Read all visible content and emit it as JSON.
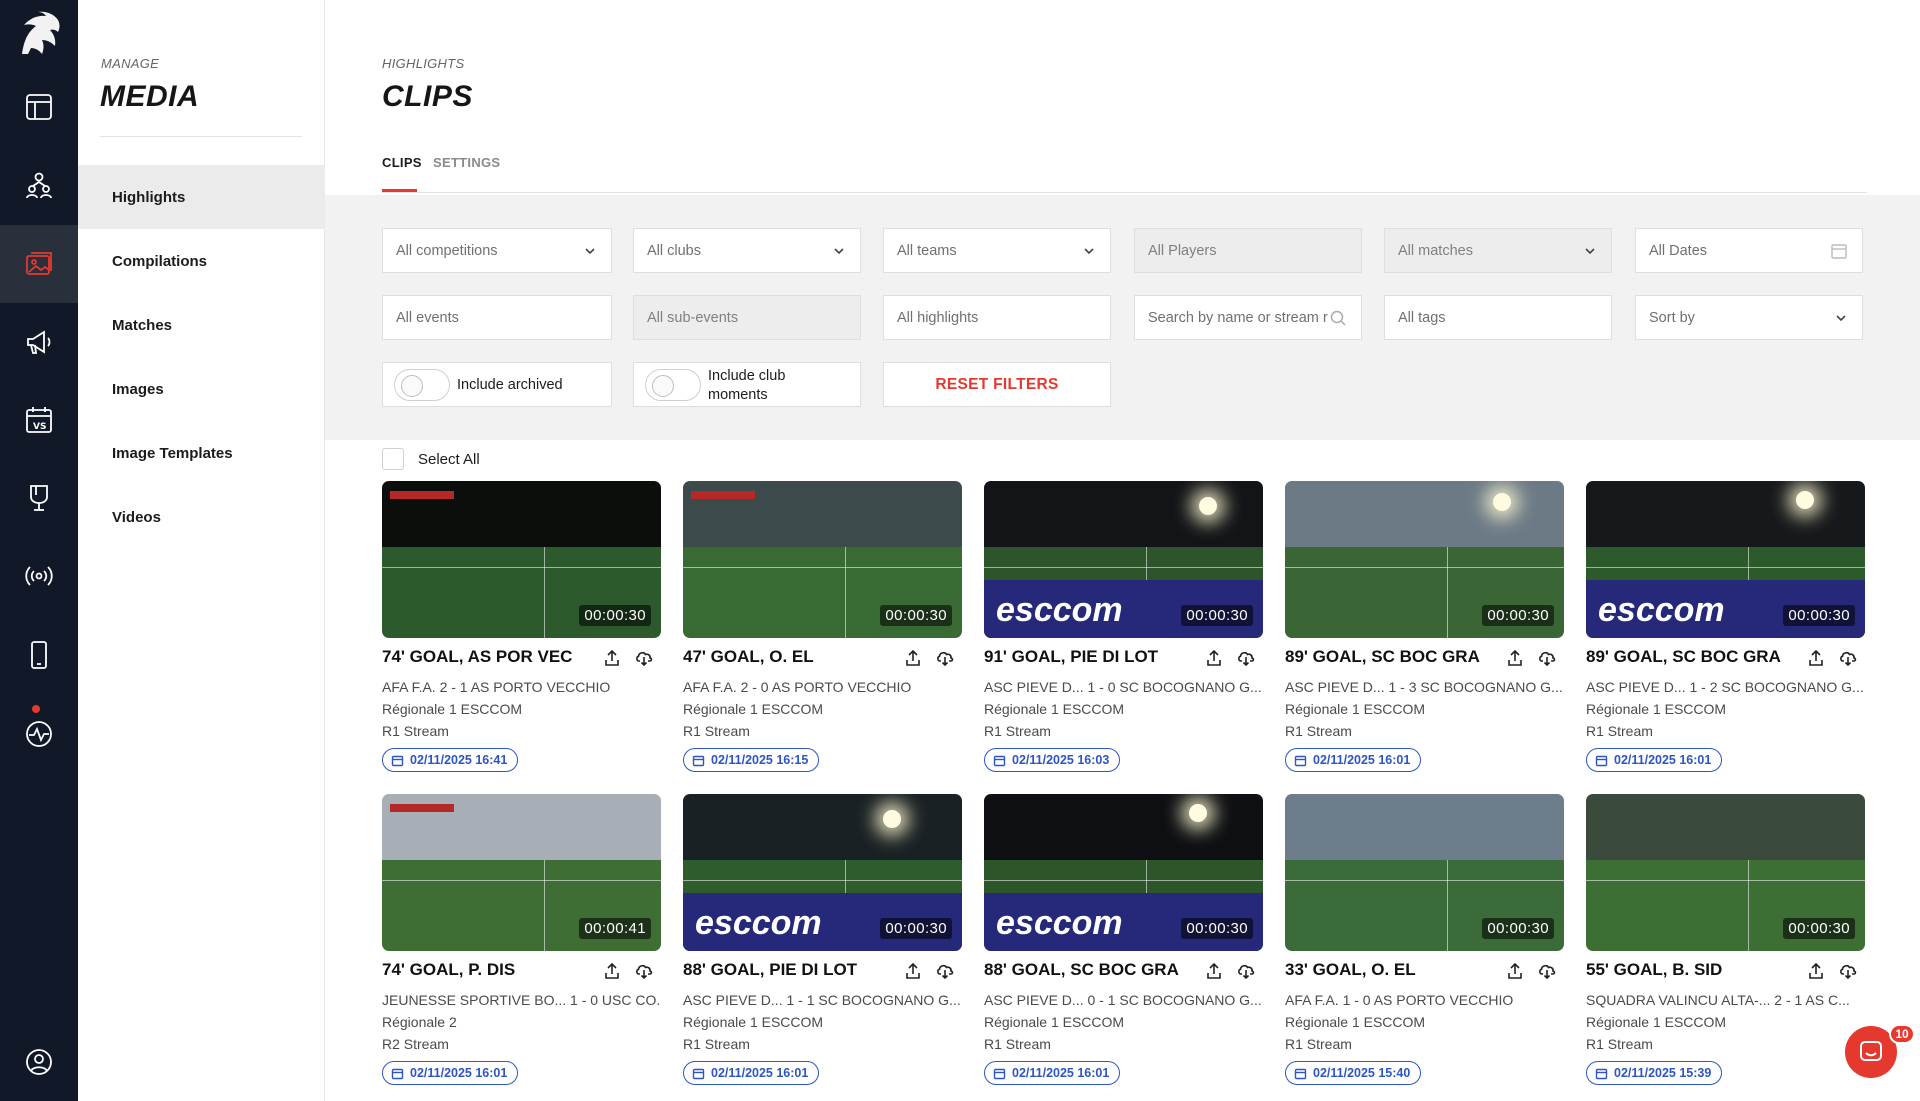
{
  "sidebar": {
    "pre_title": "MANAGE",
    "title": "MEDIA",
    "items": [
      {
        "label": "Highlights",
        "active": true
      },
      {
        "label": "Compilations"
      },
      {
        "label": "Matches"
      },
      {
        "label": "Images"
      },
      {
        "label": "Image Templates"
      },
      {
        "label": "Videos"
      }
    ]
  },
  "rail": {
    "icons": [
      "logo-icon",
      "dashboard-icon",
      "team-icon",
      "media-icon",
      "megaphone-icon",
      "match-calendar-icon",
      "trophy-icon",
      "broadcast-icon",
      "mobile-icon",
      "activity-icon",
      "profile-icon"
    ],
    "active": "media-icon",
    "accent": "#e5392f"
  },
  "header": {
    "pre_title": "HIGHLIGHTS",
    "title": "CLIPS",
    "tabs": [
      {
        "label": "CLIPS",
        "active": true
      },
      {
        "label": "SETTINGS"
      }
    ]
  },
  "filters": {
    "competitions": "All competitions",
    "clubs": "All clubs",
    "teams": "All teams",
    "players": "All Players",
    "matches": "All matches",
    "dates": "All Dates",
    "events": "All events",
    "sub_events": "All sub-events",
    "highlights": "All highlights",
    "search_placeholder": "Search by name or stream r",
    "tags": "All tags",
    "sort": "Sort by",
    "include_archived": "Include archived",
    "include_club_moments_1": "Include club",
    "include_club_moments_2": "moments",
    "reset": "RESET FILTERS"
  },
  "select_all": "Select All",
  "clips": [
    {
      "title": "74' GOAL, AS POR VEC",
      "match": "AFA F.A.  2 - 1  AS PORTO VECCHIO",
      "competition": "Régionale 1 ESCCOM",
      "stream": "R1 Stream",
      "date": "02/11/2025 16:41",
      "duration": "00:00:30"
    },
    {
      "title": "47' GOAL, O. EL",
      "match": "AFA F.A.  2 - 0  AS PORTO VECCHIO",
      "competition": "Régionale 1 ESCCOM",
      "stream": "R1 Stream",
      "date": "02/11/2025 16:15",
      "duration": "00:00:30"
    },
    {
      "title": "91' GOAL, PIE DI LOT",
      "match": "ASC PIEVE D...  1 - 0  SC BOCOGNANO G...",
      "competition": "Régionale 1 ESCCOM",
      "stream": "R1 Stream",
      "date": "02/11/2025 16:03",
      "duration": "00:00:30"
    },
    {
      "title": "89' GOAL, SC BOC GRA",
      "match": "ASC PIEVE D...  1 - 3  SC BOCOGNANO G...",
      "competition": "Régionale 1 ESCCOM",
      "stream": "R1 Stream",
      "date": "02/11/2025 16:01",
      "duration": "00:00:30"
    },
    {
      "title": "89' GOAL, SC BOC GRA",
      "match": "ASC PIEVE D...  1 - 2  SC BOCOGNANO G...",
      "competition": "Régionale 1 ESCCOM",
      "stream": "R1 Stream",
      "date": "02/11/2025 16:01",
      "duration": "00:00:30"
    },
    {
      "title": "74' GOAL, P. DIS",
      "match": "JEUNESSE SPORTIVE BO...  1 - 0  USC CO...",
      "competition": "Régionale 2",
      "stream": "R2 Stream",
      "date": "02/11/2025 16:01",
      "duration": "00:00:41"
    },
    {
      "title": "88' GOAL, PIE DI LOT",
      "match": "ASC PIEVE D...  1 - 1  SC BOCOGNANO G...",
      "competition": "Régionale 1 ESCCOM",
      "stream": "R1 Stream",
      "date": "02/11/2025 16:01",
      "duration": "00:00:30"
    },
    {
      "title": "88' GOAL, SC BOC GRA",
      "match": "ASC PIEVE D...  0 - 1  SC BOCOGNANO G...",
      "competition": "Régionale 1 ESCCOM",
      "stream": "R1 Stream",
      "date": "02/11/2025 16:01",
      "duration": "00:00:30"
    },
    {
      "title": "33' GOAL, O. EL",
      "match": "AFA F.A.  1 - 0  AS PORTO VECCHIO",
      "competition": "Régionale 1 ESCCOM",
      "stream": "R1 Stream",
      "date": "02/11/2025 15:40",
      "duration": "00:00:30"
    },
    {
      "title": "55' GOAL, B. SID",
      "match": "SQUADRA VALINCU ALTA-...  2 - 1  AS C...",
      "competition": "Régionale 1 ESCCOM",
      "stream": "R1 Stream",
      "date": "02/11/2025 15:39",
      "duration": "00:00:30"
    }
  ],
  "thumb_banner_text": "esccom",
  "chat_badge": "10"
}
